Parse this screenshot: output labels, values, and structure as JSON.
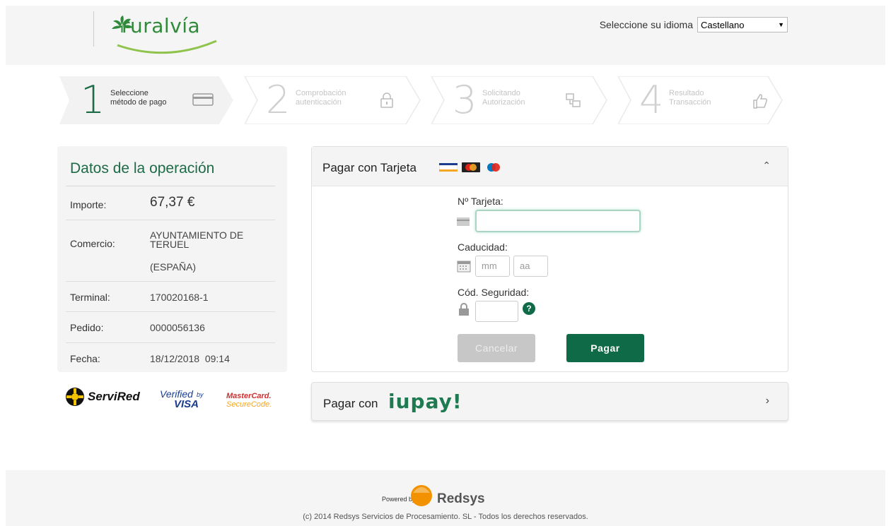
{
  "header": {
    "logo_text": "ruralvía",
    "language_label": "Seleccione su idioma",
    "language_selected": "Castellano"
  },
  "steps": [
    {
      "num": "1",
      "line1": "Seleccione",
      "line2": "método de pago",
      "icon": "credit-card-icon",
      "state": "active"
    },
    {
      "num": "2",
      "line1": "Comprobación",
      "line2": "autenticación",
      "icon": "lock-icon",
      "state": "inactive"
    },
    {
      "num": "3",
      "line1": "Solicitando",
      "line2": "Autorización",
      "icon": "transfer-icon",
      "state": "inactive"
    },
    {
      "num": "4",
      "line1": "Resultado",
      "line2": "Transacción",
      "icon": "thumbs-up-icon",
      "state": "inactive"
    }
  ],
  "operation": {
    "title": "Datos de la operación",
    "amount_label": "Importe:",
    "amount_value": "67,37 €",
    "merchant_label": "Comercio:",
    "merchant_value_line1": "AYUNTAMIENTO DE",
    "merchant_value_line2": "TERUEL",
    "merchant_value_line3": "(ESPAÑA)",
    "terminal_label": "Terminal:",
    "terminal_value": "170020168-1",
    "order_label": "Pedido:",
    "order_value": "0000056136",
    "date_label": "Fecha:",
    "date_value": "18/12/2018  09:14"
  },
  "brands": {
    "servired": "ServiRed",
    "verified_line1": "Verified",
    "verified_by": "by",
    "verified_line2": "VISA",
    "mastercard_line1": "MasterCard.",
    "mastercard_line2": "SecureCode."
  },
  "card_panel": {
    "title": "Pagar con Tarjeta",
    "card_label": "Nº Tarjeta:",
    "card_value": "",
    "expiry_label": "Caducidad:",
    "month_placeholder": "mm",
    "year_placeholder": "aa",
    "cvv_label": "Cód. Seguridad:",
    "cvv_value": "",
    "help_glyph": "?",
    "cancel_label": "Cancelar",
    "pay_label": "Pagar",
    "visa_text": "VISA"
  },
  "iupay_panel": {
    "title": "Pagar con",
    "logo": "iupay!"
  },
  "footer": {
    "powered_by": "Powered by",
    "redsys": "Redsys",
    "copyright": "(c) 2014 Redsys Servicios de Procesamiento. SL - Todos los derechos reservados."
  },
  "colors": {
    "brand_green": "#0e6a47",
    "title_green": "#1e6b48",
    "logo_green": "#2f8a3a",
    "redsys_orange": "#f39200"
  }
}
